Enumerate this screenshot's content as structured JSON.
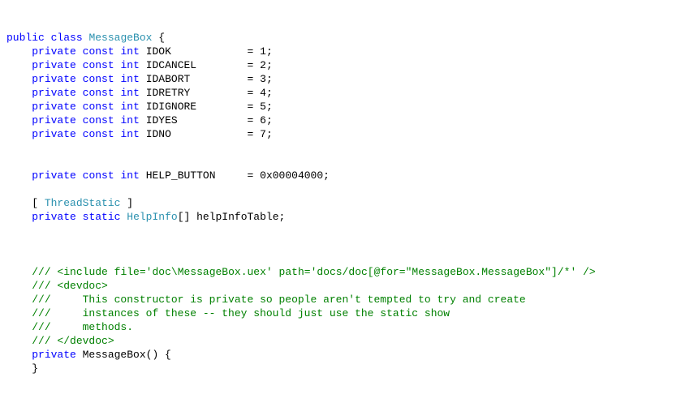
{
  "line1": {
    "kw_public": "public",
    "kw_class": "class",
    "type_name": "MessageBox",
    "brace": " {"
  },
  "consts": [
    {
      "name": "IDOK",
      "pad": "           ",
      "val": "1"
    },
    {
      "name": "IDCANCEL",
      "pad": "       ",
      "val": "2"
    },
    {
      "name": "IDABORT",
      "pad": "        ",
      "val": "3"
    },
    {
      "name": "IDRETRY",
      "pad": "        ",
      "val": "4"
    },
    {
      "name": "IDIGNORE",
      "pad": "       ",
      "val": "5"
    },
    {
      "name": "IDYES",
      "pad": "          ",
      "val": "6"
    },
    {
      "name": "IDNO",
      "pad": "           ",
      "val": "7"
    }
  ],
  "help_const": {
    "kw_private": "private",
    "kw_const": "const",
    "kw_int": "int",
    "name": "HELP_BUTTON",
    "pad": "    ",
    "val": "0x00004000"
  },
  "attr": {
    "open": "[ ",
    "name": "ThreadStatic",
    "close": " ]"
  },
  "field": {
    "kw_private": "private",
    "kw_static": "static",
    "type": "HelpInfo",
    "arr": "[] helpInfoTable;"
  },
  "doc": {
    "l1a": "/// <",
    "l1b": "include file",
    "l1c": "=",
    "l1d": "'",
    "l1e": "doc\\MessageBox.uex",
    "l1f": "'",
    "l1g": " ",
    "l1h": "path",
    "l1i": "=",
    "l1j": "'",
    "l1k": "docs/doc[@for=\"MessageBox.MessageBox\"]/*",
    "l1l": "'",
    "l1m": " />",
    "l2": "/// <devdoc>",
    "l3": "///     This constructor is private so people aren't tempted to try and create",
    "l4": "///     instances of these -- they should just use the static show",
    "l5": "///     methods.",
    "l6": "/// </devdoc>"
  },
  "ctor": {
    "kw_private": "private",
    "name": " MessageBox() {",
    "close": "}"
  }
}
